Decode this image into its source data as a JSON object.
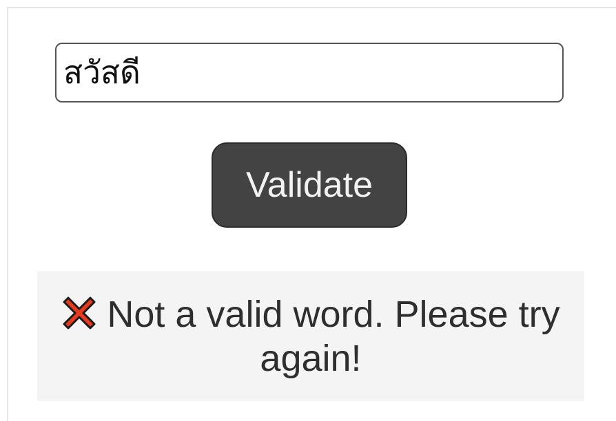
{
  "form": {
    "word_value": "สวัสดี",
    "validate_label": "Validate"
  },
  "result": {
    "icon": "cross-icon",
    "message": "Not a valid word. Please try again!",
    "icon_color": "#e53a1e"
  }
}
